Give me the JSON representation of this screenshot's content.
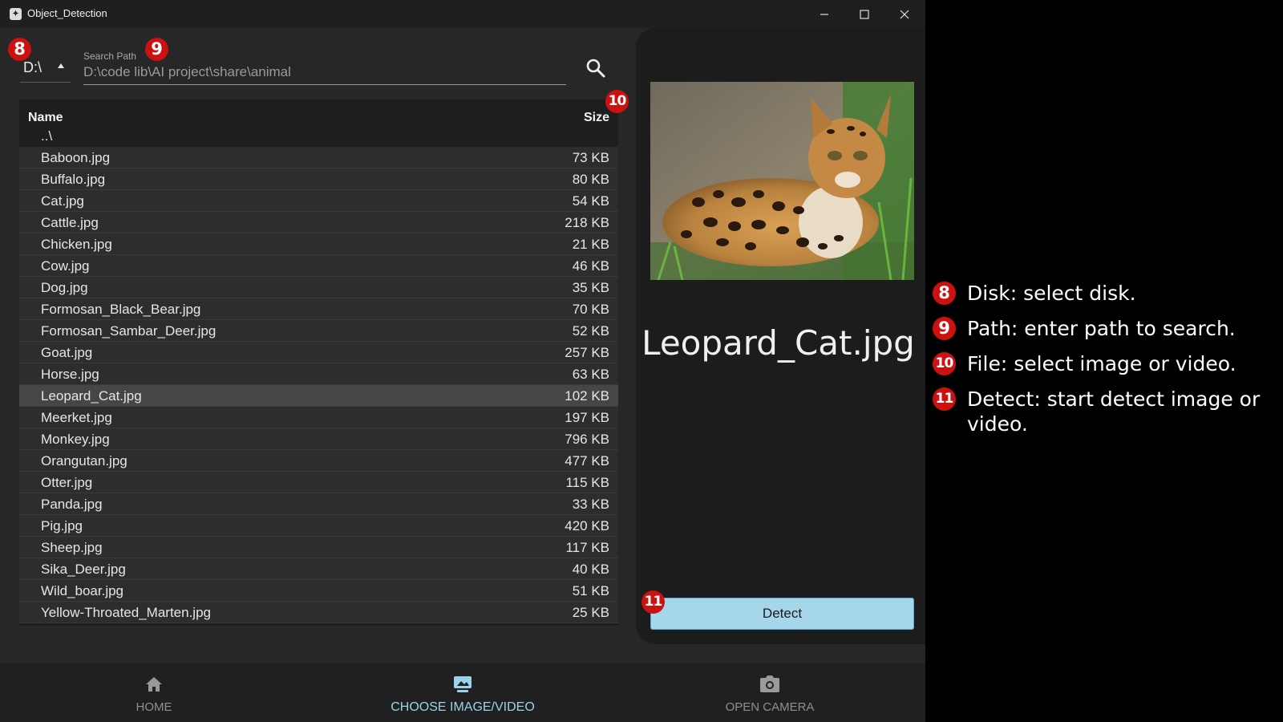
{
  "window": {
    "title": "Object_Detection",
    "icon": "app-logo-icon",
    "controls": [
      "minimize-icon",
      "maximize-icon",
      "close-icon"
    ]
  },
  "disk": {
    "value": "D:\\"
  },
  "search": {
    "label": "Search Path",
    "value": "D:\\code lib\\AI project\\share\\animal",
    "button_icon": "search-icon"
  },
  "file_list": {
    "header": {
      "name": "Name",
      "size": "Size"
    },
    "parent": "..\\",
    "selected_index": 12,
    "rows": [
      {
        "name": "Baboon.jpg",
        "size": "73 KB"
      },
      {
        "name": "Buffalo.jpg",
        "size": "80 KB"
      },
      {
        "name": "Cat.jpg",
        "size": "54 KB"
      },
      {
        "name": "Cattle.jpg",
        "size": "218 KB"
      },
      {
        "name": "Chicken.jpg",
        "size": "21 KB"
      },
      {
        "name": "Cow.jpg",
        "size": "46 KB"
      },
      {
        "name": "Dog.jpg",
        "size": "35 KB"
      },
      {
        "name": "Formosan_Black_Bear.jpg",
        "size": "70 KB"
      },
      {
        "name": "Formosan_Sambar_Deer.jpg",
        "size": "52 KB"
      },
      {
        "name": "Goat.jpg",
        "size": "257 KB"
      },
      {
        "name": "Horse.jpg",
        "size": "63 KB"
      },
      {
        "name": "Leopard_Cat.jpg",
        "size": "102 KB"
      },
      {
        "name": "Meerket.jpg",
        "size": "197 KB"
      },
      {
        "name": "Monkey.jpg",
        "size": "796 KB"
      },
      {
        "name": "Orangutan.jpg",
        "size": "477 KB"
      },
      {
        "name": "Otter.jpg",
        "size": "115 KB"
      },
      {
        "name": "Panda.jpg",
        "size": "33 KB"
      },
      {
        "name": "Pig.jpg",
        "size": "420 KB"
      },
      {
        "name": "Sheep.jpg",
        "size": "117 KB"
      },
      {
        "name": "Sika_Deer.jpg",
        "size": "40 KB"
      },
      {
        "name": "Wild_boar.jpg",
        "size": "51 KB"
      },
      {
        "name": "Yellow-Throated_Marten.jpg",
        "size": "25 KB"
      }
    ]
  },
  "preview": {
    "filename": "Leopard_Cat.jpg",
    "detect_label": "Detect"
  },
  "nav": {
    "home": {
      "label": "HOME",
      "icon": "home-icon"
    },
    "choose": {
      "label": "CHOOSE IMAGE/VIDEO",
      "icon": "image-video-icon"
    },
    "camera": {
      "label": "OPEN CAMERA",
      "icon": "camera-icon"
    },
    "active": "choose"
  },
  "badges": {
    "b8": "8",
    "b9": "9",
    "b10": "10",
    "b11": "11"
  },
  "annotations": [
    {
      "num": "8",
      "text": "Disk: select disk."
    },
    {
      "num": "9",
      "text": "Path: enter path to search."
    },
    {
      "num": "10",
      "text": "File: select image or video."
    },
    {
      "num": "11",
      "text": "Detect: start detect image or video."
    }
  ],
  "colors": {
    "accent": "#a6d6ea",
    "nav_active": "#9ad3ea",
    "badge": "#cc1111",
    "window_bg": "#272727"
  }
}
